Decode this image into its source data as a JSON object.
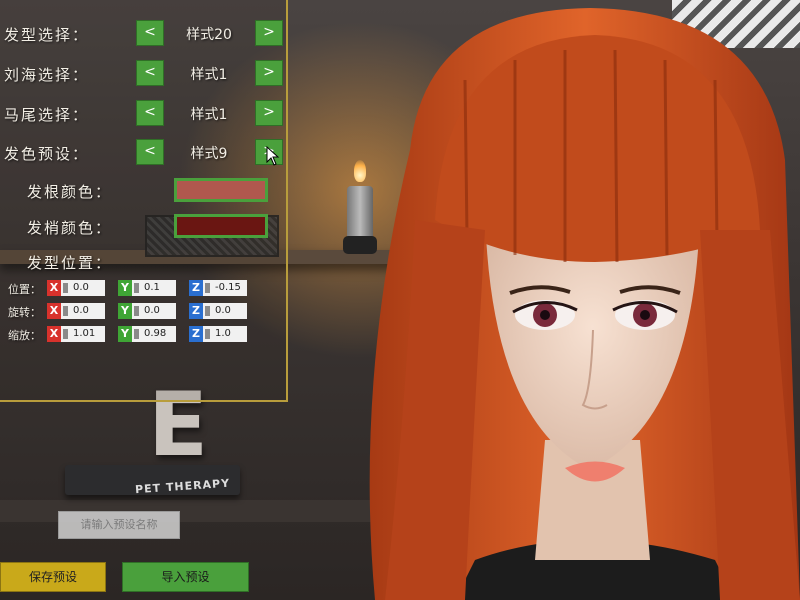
{
  "scene": {
    "book_label": "PET THERAPY",
    "letter": "E"
  },
  "hair": {
    "rows": [
      {
        "label": "发型选择：",
        "value": "样式20",
        "prev": "<",
        "next": ">"
      },
      {
        "label": "刘海选择：",
        "value": "样式1",
        "prev": "<",
        "next": ">"
      },
      {
        "label": "马尾选择：",
        "value": "样式1",
        "prev": "<",
        "next": ">"
      },
      {
        "label": "发色预设：",
        "value": "样式9",
        "prev": "<",
        "next": ">"
      }
    ],
    "root_color_label": "发根颜色：",
    "root_color": "#b0584e",
    "tip_color_label": "发梢颜色：",
    "tip_color": "#6a1612",
    "position_title": "发型位置："
  },
  "transform": {
    "position": {
      "label": "位置：",
      "x": "0.0",
      "y": "0.1",
      "z": "-0.15"
    },
    "rotation": {
      "label": "旋转：",
      "x": "0.0",
      "y": "0.0",
      "z": "0.0"
    },
    "scale": {
      "label": "缩放：",
      "x": "1.01",
      "y": "0.98",
      "z": "1.0"
    },
    "axis_x": "X",
    "axis_y": "Y",
    "axis_z": "Z"
  },
  "preset": {
    "name_placeholder": "请输入预设名称",
    "save_label": "保存预设",
    "import_label": "导入预设"
  },
  "colors": {
    "accent_green": "#4aa03c",
    "accent_gold": "#c9a91a",
    "panel_border": "#b89d3c"
  }
}
